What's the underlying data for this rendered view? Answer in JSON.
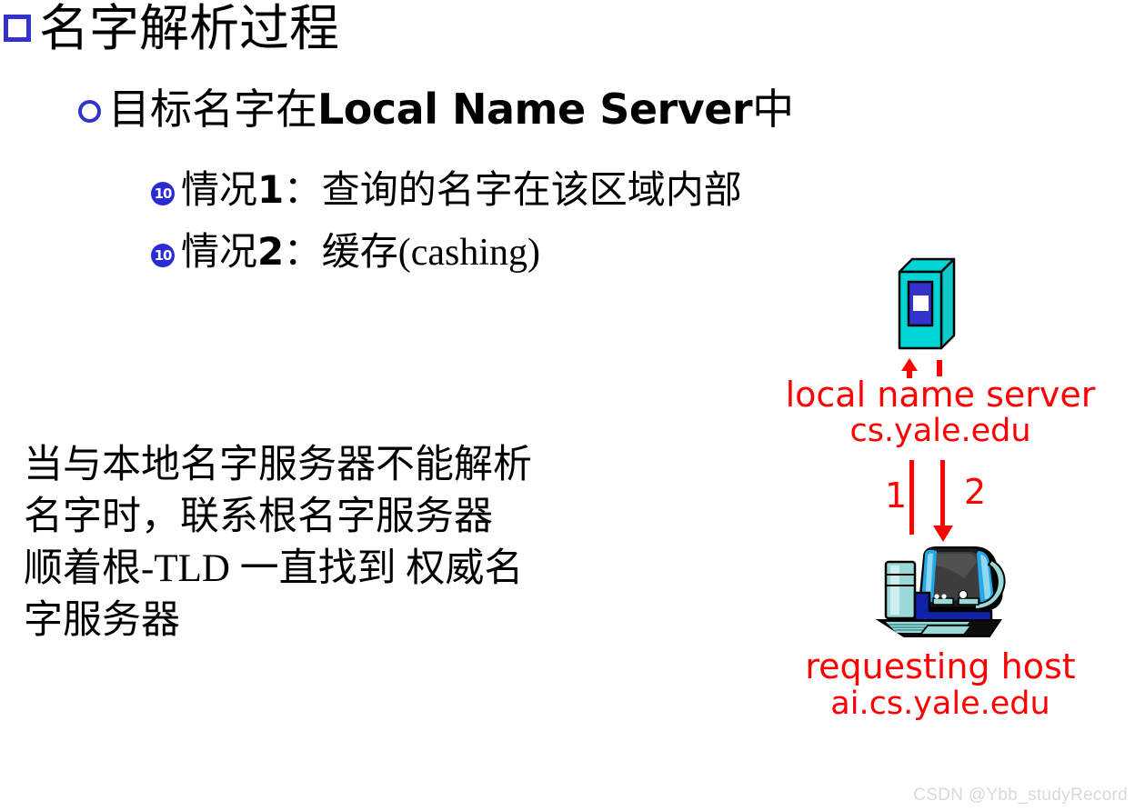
{
  "slide": {
    "outline": {
      "level1": {
        "marker": "square-bullet-icon",
        "text": "名字解析过程"
      },
      "level2": {
        "marker": "circle-bullet-icon",
        "text_cjk_before": "目标名字在",
        "text_latin": "Local Name Server",
        "text_cjk_after": "中"
      },
      "level3": [
        {
          "marker": "circled-ten-bullet-icon",
          "marker_label": "10",
          "text_prefix": "情况",
          "text_number": "1",
          "text_suffix": "：查询的名字在该区域内部"
        },
        {
          "marker": "circled-ten-bullet-icon",
          "marker_label": "10",
          "text_prefix": "情况",
          "text_number": "2",
          "text_suffix": "：缓存(cashing)"
        }
      ]
    },
    "note_paragraph": "当与本地名字服务器不能解析\n名字时，联系根名字服务器\n顺着根-TLD 一直找到 权威名\n字服务器"
  },
  "diagram": {
    "server": {
      "icon": "server-tower-icon",
      "caption_line1": "local name server",
      "caption_line2": "cs.yale.edu"
    },
    "host": {
      "icon": "desktop-computer-icon",
      "caption_line1": "requesting host",
      "caption_line2": "ai.cs.yale.edu"
    },
    "arrows": [
      {
        "label": "1",
        "direction": "up",
        "name": "query-arrow"
      },
      {
        "label": "2",
        "direction": "down",
        "name": "reply-arrow"
      }
    ]
  },
  "watermark": "CSDN @Ybb_studyRecord",
  "colors": {
    "bullet_blue": "#3333CC",
    "marker_blue": "#2B2BD4",
    "accent_red": "#FF0000",
    "server_cyan": "#00D5D5",
    "server_panel_blue": "#3333CC",
    "watermark_gray": "#D9D9D9",
    "text_black": "#000000",
    "background": "#FFFFFF"
  }
}
